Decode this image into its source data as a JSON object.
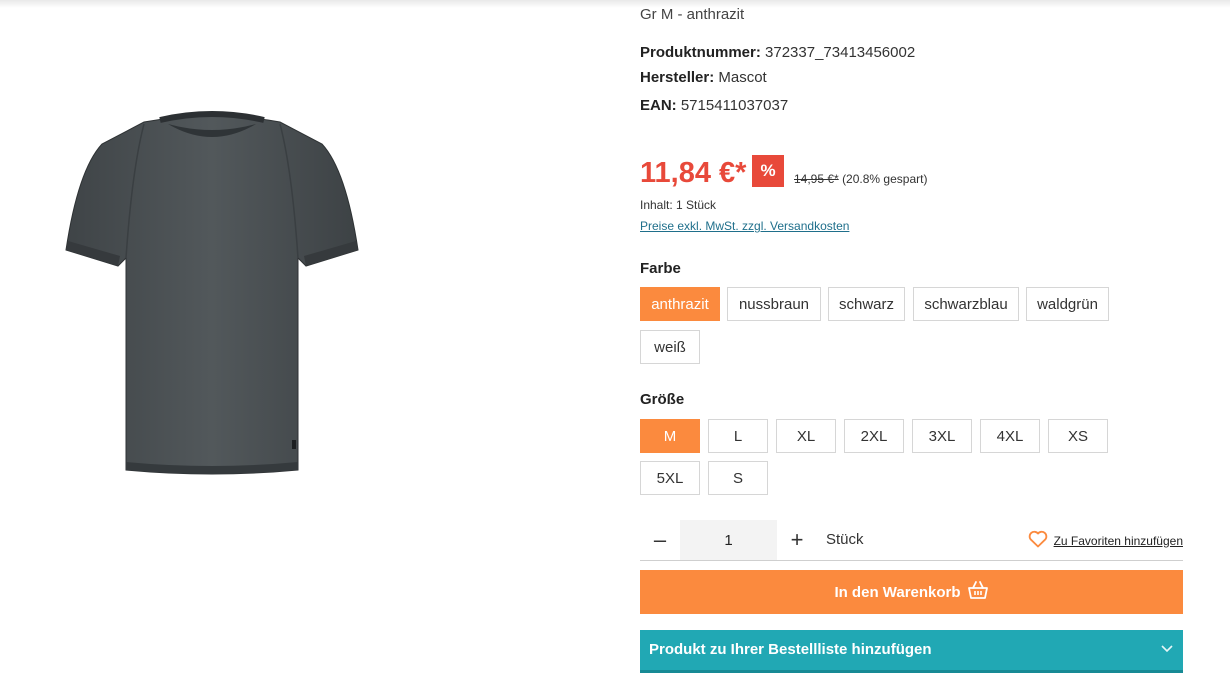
{
  "product": {
    "variant": "Gr M - anthrazit",
    "number_label": "Produktnummer:",
    "number_value": "372337_73413456002",
    "maker_label": "Hersteller:",
    "maker_value": "Mascot",
    "ean_label": "EAN:",
    "ean_value": "5715411037037"
  },
  "price": {
    "current": "11,84 €*",
    "badge": "%",
    "old": "14,95 €*",
    "saving": "(20.8% gespart)",
    "content": "Inhalt: 1 Stück",
    "tax_link": "Preise exkl. MwSt. zzgl. Versandkosten"
  },
  "color": {
    "label": "Farbe",
    "options": [
      "anthrazit",
      "nussbraun",
      "schwarz",
      "schwarzblau",
      "waldgrün",
      "weiß"
    ],
    "selected": "anthrazit"
  },
  "size": {
    "label": "Größe",
    "options": [
      "M",
      "L",
      "XL",
      "2XL",
      "3XL",
      "4XL",
      "XS",
      "5XL",
      "S"
    ],
    "selected": "M"
  },
  "quantity": {
    "value": "1",
    "unit": "Stück",
    "minus": "–",
    "plus": "+"
  },
  "favorites": {
    "label": "Zu Favoriten hinzufügen"
  },
  "cart": {
    "label": "In den Warenkorb"
  },
  "order_list": {
    "label": "Produkt zu Ihrer Bestellliste hinzufügen"
  },
  "colors": {
    "accent": "#fb8a3e",
    "price": "#e8493a",
    "teal": "#21a8b4"
  }
}
